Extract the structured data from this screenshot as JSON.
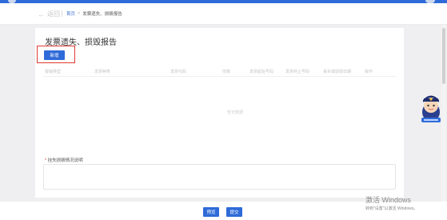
{
  "header": {
    "back_label": "返回",
    "breadcrumb_home": "首页",
    "breadcrumb_separator": ">",
    "breadcrumb_current": "发票遗失、损毁报告"
  },
  "page": {
    "title": "发票遗失、损毁报告",
    "add_button": "新增",
    "empty_text": "暂无数据"
  },
  "table": {
    "columns": [
      "报销类型",
      "发票种类",
      "发票代码",
      "份数",
      "发票起始号码",
      "发票终止号码",
      "丢失或损毁日期",
      "操作"
    ]
  },
  "reason": {
    "required_mark": "*",
    "label": "挂失损毁情况说明",
    "value": ""
  },
  "footer": {
    "preview_button": "预览",
    "submit_button": "提交"
  },
  "watermark": {
    "line1": "激活 Windows",
    "line2": "转到\"设置\"以激活 Windows。"
  },
  "colors": {
    "primary": "#2f6bd8",
    "highlight": "#e03a32"
  },
  "icons": {
    "back": "arrow-left-icon",
    "assistant": "assistant-avatar-icon"
  }
}
